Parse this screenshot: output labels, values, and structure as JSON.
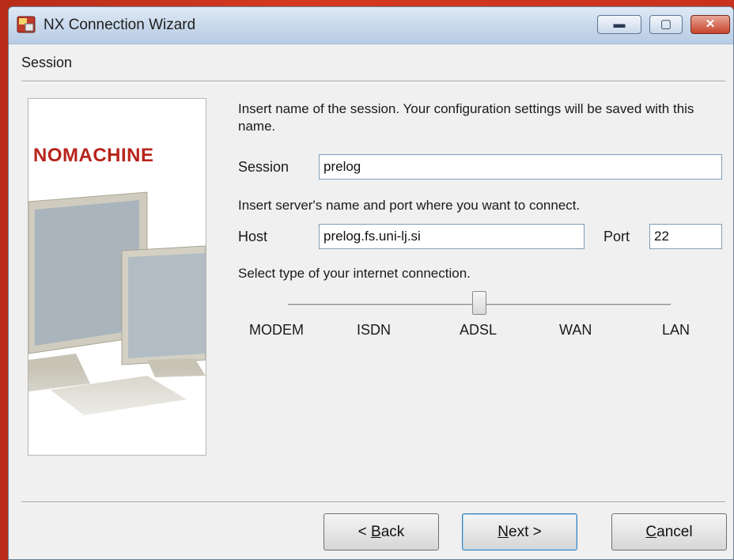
{
  "window": {
    "title": "NX Connection Wizard",
    "controls": {
      "minimize": "▬",
      "maximize": "▢",
      "close": "✕"
    }
  },
  "header": {
    "section": "Session"
  },
  "banner": {
    "brand": "NOMACHINE"
  },
  "form": {
    "session_prompt": "Insert name of the session. Your configuration settings will be saved with this name.",
    "session_label": "Session",
    "session_value": "prelog",
    "host_prompt": "Insert server's name and port where you want to connect.",
    "host_label": "Host",
    "host_value": "prelog.fs.uni-lj.si",
    "port_label": "Port",
    "port_value": "22",
    "connection_prompt": "Select type of your internet connection.",
    "connection_types": [
      "MODEM",
      "ISDN",
      "ADSL",
      "WAN",
      "LAN"
    ],
    "connection_selected": "ADSL"
  },
  "buttons": {
    "back_mnemonic": "B",
    "back_rest": "ack",
    "back_prefix": "< ",
    "next_mnemonic": "N",
    "next_rest": "ext >",
    "cancel_mnemonic": "C",
    "cancel_rest": "ancel"
  },
  "colors": {
    "brand_red": "#b8241c",
    "desktop_bg": "#c8321e",
    "dialog_bg": "#f0f0f0"
  }
}
